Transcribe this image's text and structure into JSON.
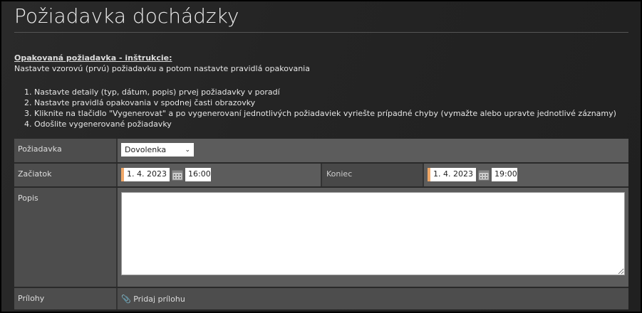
{
  "title": "Požiadavka dochádzky",
  "instructions": {
    "heading": "Opakovaná požiadavka - inštrukcie:",
    "intro": "Nastavte vzorovú (prvú) požiadavku a potom nastavte pravidlá opakovania",
    "steps": [
      "Nastavte detaily (typ, dátum, popis) prvej požiadavky v poradí",
      "Nastavte pravidlá opakovania v spodnej časti obrazovky",
      "Kliknite na tlačidlo \"Vygenerovat\" a po vygenerovaní jednotlivých požiadaviek vyriešte prípadné chyby (vymažte alebo upravte jednotlivé záznamy)",
      "Odošlite vygenerované požiadavky"
    ]
  },
  "form": {
    "request_label": "Požiadavka",
    "request_value": "Dovolenka",
    "start_label": "Začiatok",
    "start_date": "1. 4. 2023",
    "start_time": "16:00",
    "end_label": "Koniec",
    "end_date": "1. 4. 2023",
    "end_time": "19:00",
    "description_label": "Popis",
    "description_value": "",
    "attachments_label": "Prílohy",
    "add_attachment": "Pridaj prílohu"
  },
  "colors": {
    "accent": "#f0a868"
  }
}
